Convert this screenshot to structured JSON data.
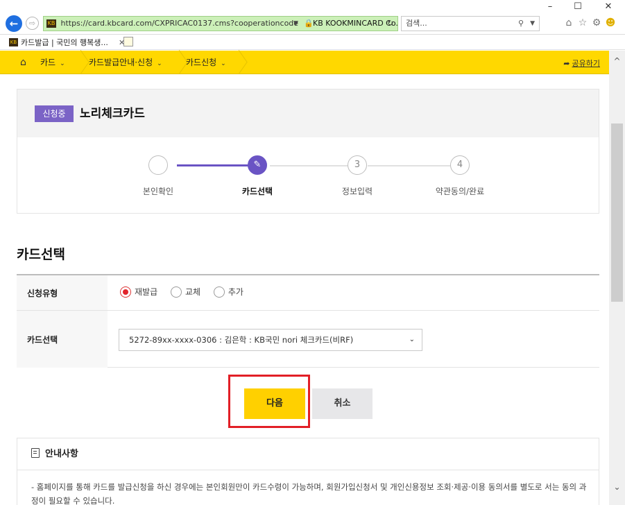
{
  "browser": {
    "url": "https://card.kbcard.com/CXPRICAC0137.cms?cooperationcode",
    "url_host_bold": "card.kbcard.com",
    "cert_label": "KB KOOKMINCARD Co.,L...",
    "search_placeholder": "검색...",
    "tab_title": "카드발급 | 국민의 행복생...",
    "window_buttons": {
      "minimize": "–",
      "maximize": "☐",
      "close": "✕"
    }
  },
  "gnb": {
    "items": [
      {
        "label": "카드"
      },
      {
        "label": "카드발급안내·신청"
      },
      {
        "label": "카드신청"
      }
    ],
    "share_label": "공유하기"
  },
  "header": {
    "status_badge": "신청중",
    "card_name": "노리체크카드"
  },
  "steps": [
    {
      "number": "",
      "label": "본인확인",
      "state": "done"
    },
    {
      "number": "✎",
      "label": "카드선택",
      "state": "active"
    },
    {
      "number": "3",
      "label": "정보입력",
      "state": "pending"
    },
    {
      "number": "4",
      "label": "약관동의/완료",
      "state": "pending"
    }
  ],
  "section": {
    "title": "카드선택"
  },
  "form": {
    "type_label": "신청유형",
    "type_options": [
      {
        "label": "재발급",
        "checked": true
      },
      {
        "label": "교체",
        "checked": false
      },
      {
        "label": "추가",
        "checked": false
      }
    ],
    "card_label": "카드선택",
    "card_selected": "5272-89xx-xxxx-0306 : 김은학 : KB국민 nori 체크카드(비RF)"
  },
  "buttons": {
    "next": "다음",
    "cancel": "취소"
  },
  "notice": {
    "title": "안내사항",
    "text": "- 홈페이지를 통해 카드를 발급신청을 하신 경우에는 본인회원만이 카드수령이 가능하며, 회원가입신청서 및 개인신용정보 조회·제공·이용 동의서를 별도로 서는 동의 과정이 필요할 수 있습니다."
  },
  "colors": {
    "brand_yellow": "#ffd800",
    "step_purple": "#6a54c4",
    "badge_purple": "#7b63c6",
    "highlight_red": "#e21f26",
    "radio_red": "#e2242b"
  }
}
